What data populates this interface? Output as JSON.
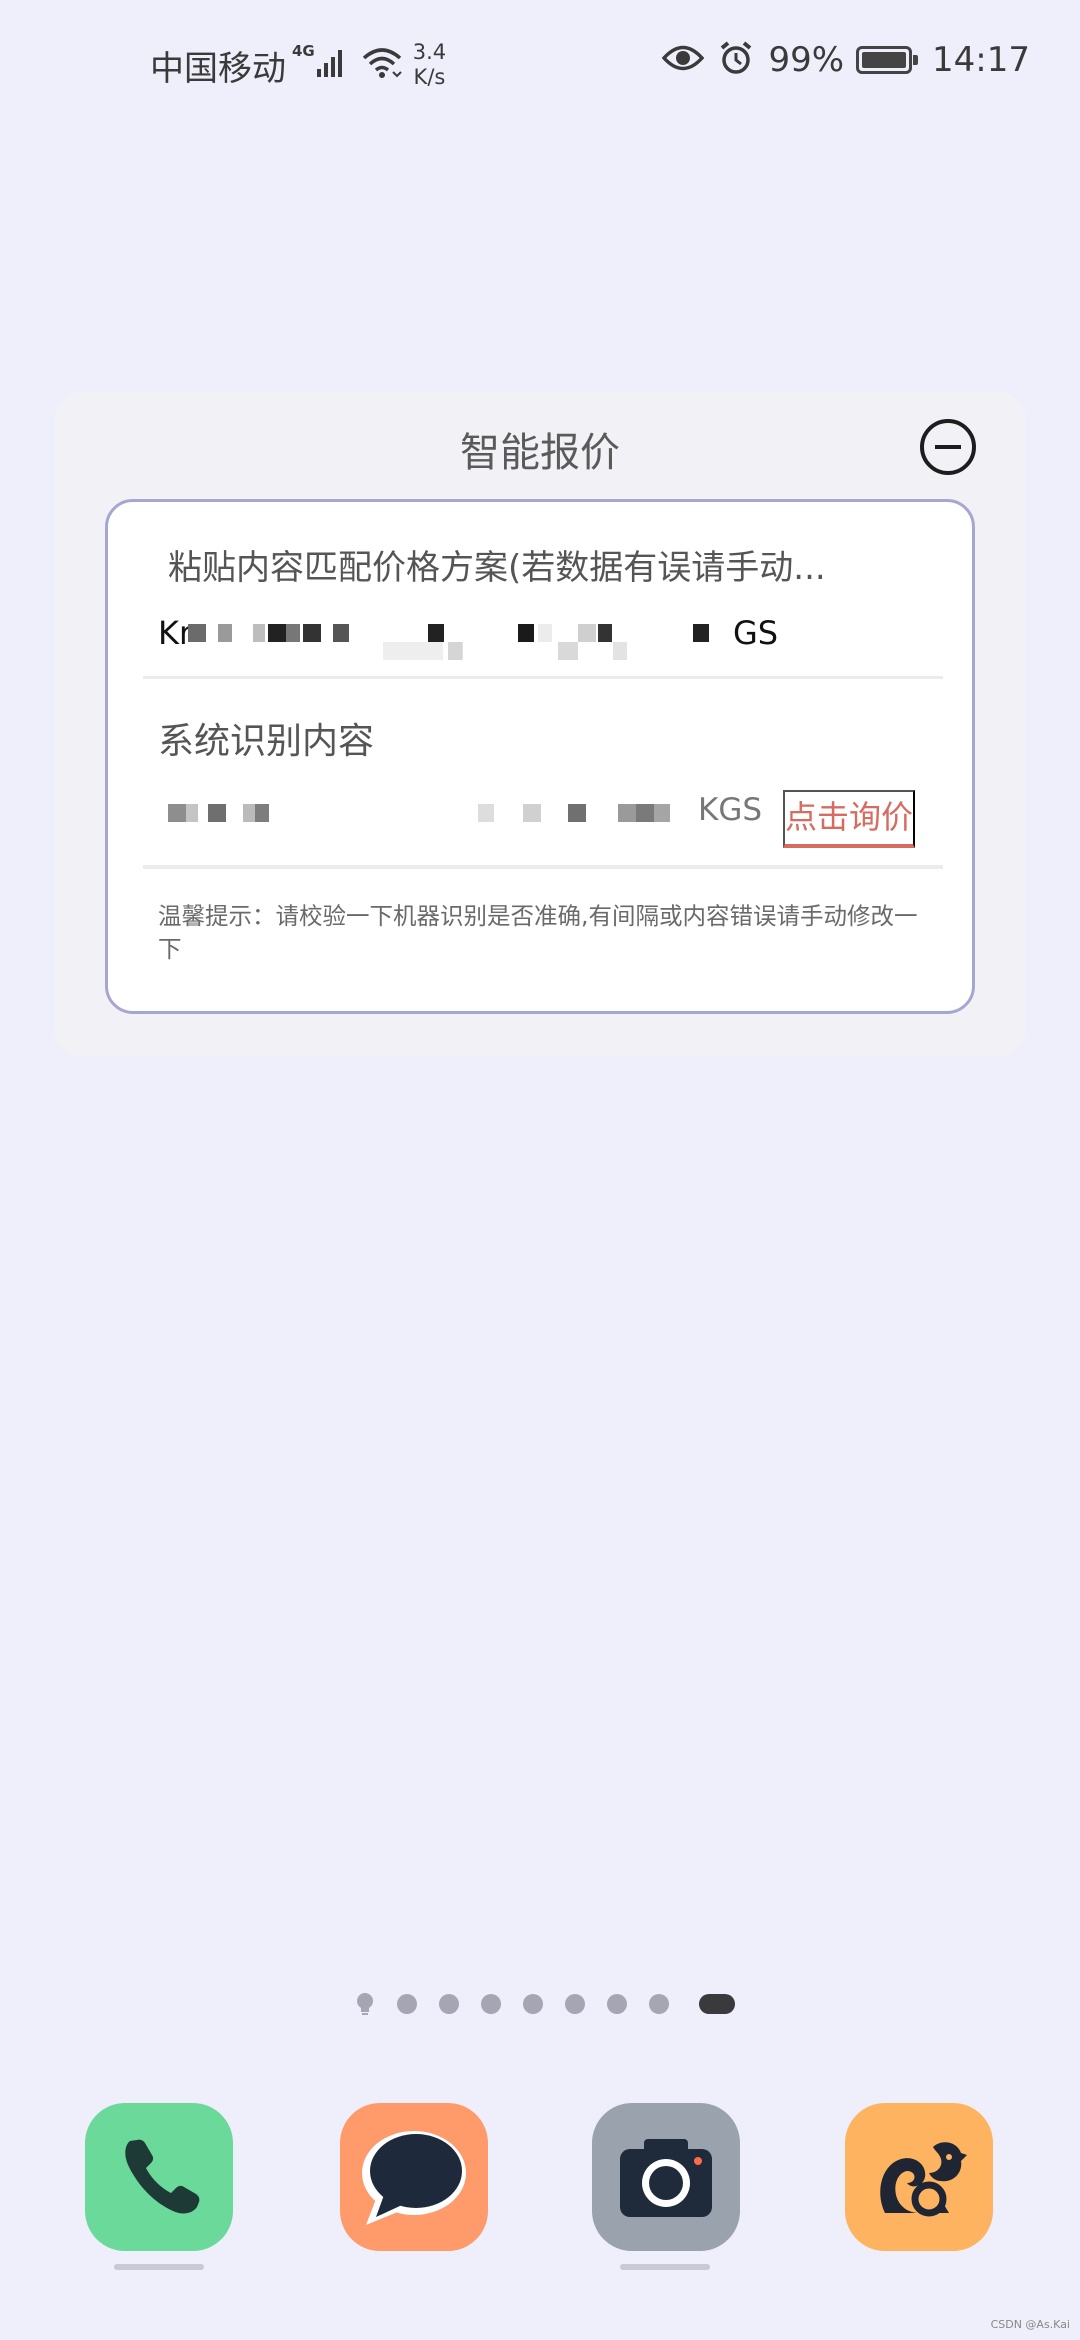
{
  "status_bar": {
    "carrier": "中国移动",
    "network_type": "4G",
    "speed_value": "3.4",
    "speed_unit": "K/s",
    "battery_percent": "99%",
    "time": "14:17",
    "icons": [
      "signal-icon",
      "wifi-icon",
      "eye-icon",
      "alarm-icon",
      "battery-icon"
    ]
  },
  "widget": {
    "title": "智能报价",
    "paste_placeholder": "粘贴内容匹配价格方案(若数据有误请手动...",
    "pasted_text_prefix": "Kr",
    "pasted_text_suffix": "GS",
    "recognized_label": "系统识别内容",
    "recognized_suffix": "KGS",
    "query_button": "点击询价",
    "tip": "温馨提示：请校验一下机器识别是否准确,有间隔或内容错误请手动修改一下"
  },
  "page_indicator": {
    "total_pages": 8,
    "current_page": 8
  },
  "dock": {
    "apps": [
      "phone-app",
      "messages-app",
      "camera-app",
      "uc-browser-app"
    ]
  },
  "watermark": "CSDN @As.Kai",
  "colors": {
    "background": "#efeffb",
    "accent_red": "#d76b5f",
    "card_border": "#a6a6d2",
    "phone_green": "#6ad99a",
    "message_orange": "#ff9a6b",
    "camera_gray": "#9aa2ae",
    "uc_orange": "#fdb35f"
  }
}
